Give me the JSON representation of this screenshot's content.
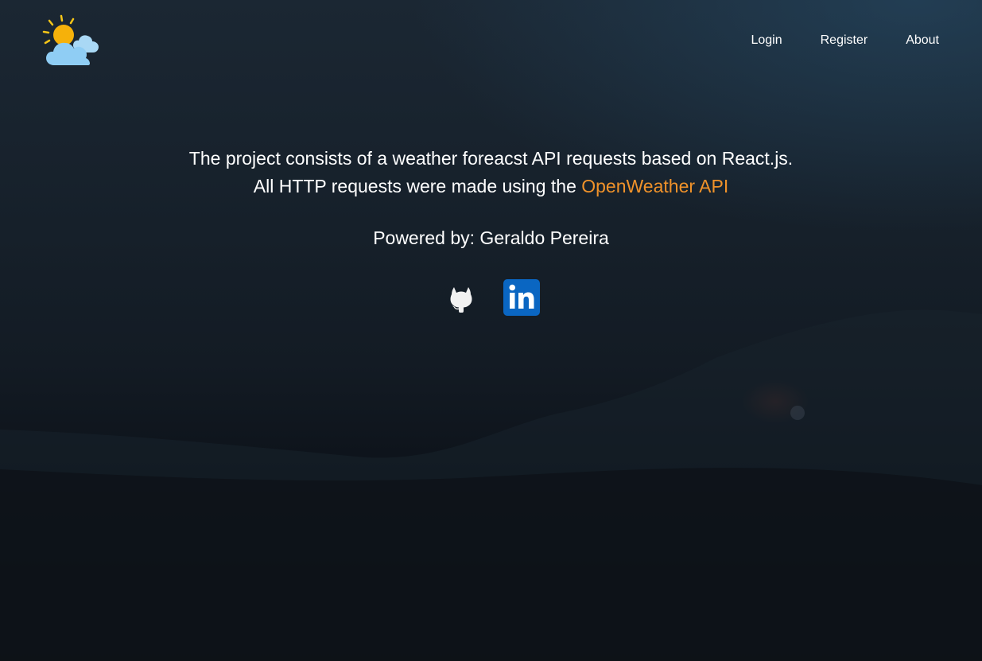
{
  "nav": {
    "logo_icon": "sun-behind-cloud-icon",
    "links": [
      "Login",
      "Register",
      "About"
    ]
  },
  "main": {
    "line1": "The project consists of a weather foreacst API requests based on React.js.",
    "line2_prefix": "All HTTP requests were made using the",
    "api_link_label": "OpenWeather API",
    "powered_by": "Powered by: Geraldo Pereira"
  },
  "socials": [
    {
      "icon": "github-icon"
    },
    {
      "icon": "linkedin-icon"
    }
  ],
  "colors": {
    "accent": "#f0922a",
    "text": "#ffffff",
    "linkedin": "#0a66c2"
  }
}
